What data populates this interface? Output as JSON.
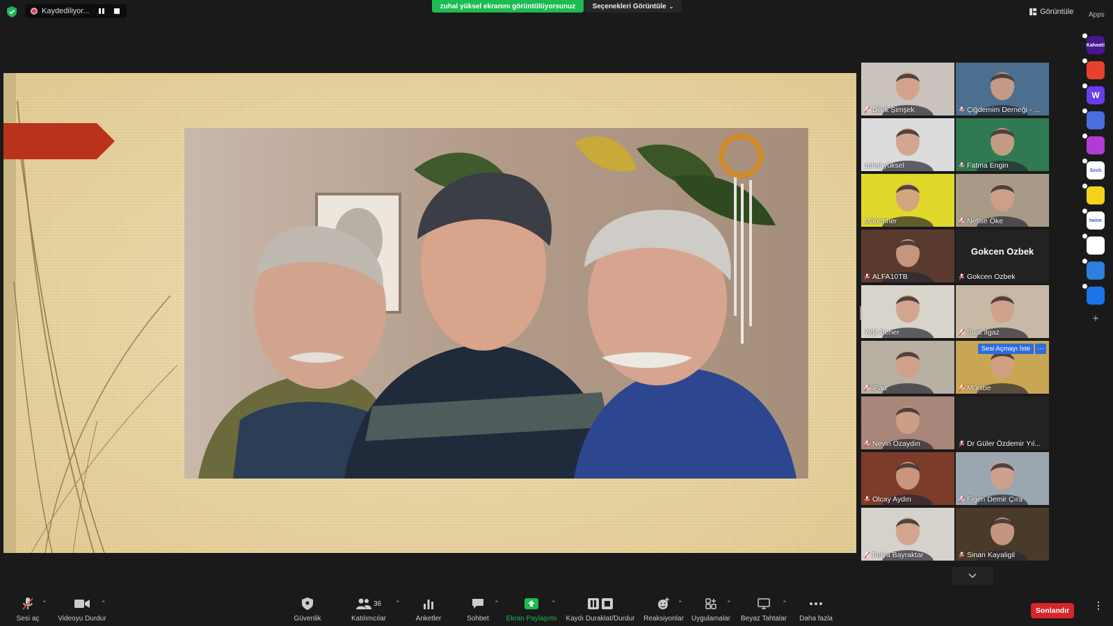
{
  "top": {
    "recording_label": "Kaydediliyor...",
    "share_banner": "zuhal yüksel ekranını görüntülüyorsunuz",
    "view_options": "Seçenekleri Görüntüle",
    "view_button": "Görüntüle",
    "apps_label": "Apps"
  },
  "gallery": {
    "tiles": [
      {
        "name": "Dilek Şimşek",
        "muted": true,
        "active": true,
        "bg": "#c9c2bd"
      },
      {
        "name": "Çiğdemim Derneği - ...",
        "muted": true,
        "bg": "#4c6f8f"
      },
      {
        "name": "zuhal yüksel",
        "muted": false,
        "bg": "#dcdcdc"
      },
      {
        "name": "Fatma Engin",
        "muted": true,
        "bg": "#2f7a52"
      },
      {
        "name": "Mübehher",
        "muted": false,
        "bg": "#e0d82a"
      },
      {
        "name": "Nefise Öke",
        "muted": true,
        "bg": "#a99a88"
      },
      {
        "name": "ALFA10TB",
        "muted": true,
        "bg": "#5a3a2e"
      },
      {
        "name": "Gokcen Ozbek",
        "muted": true,
        "bg": "#222222",
        "big_name": "Gokcen Ozbek"
      },
      {
        "name": "Yiğit Bener",
        "muted": false,
        "bg": "#d8d4cc"
      },
      {
        "name": "Suat Ilgaz",
        "muted": true,
        "bg": "#c7b9a6"
      },
      {
        "name": "iPad",
        "muted": true,
        "bg": "#b9b0a4"
      },
      {
        "name": "Münibe",
        "muted": true,
        "bg": "#c9a653",
        "ask_unmute": "Sesi Açmayı İste"
      },
      {
        "name": "Nevin Özaydın",
        "muted": true,
        "bg": "#a8867a"
      },
      {
        "name": "Dr Güler Özdemir Yıl...",
        "muted": true,
        "bg": "#222222"
      },
      {
        "name": "Olcay Aydın",
        "muted": true,
        "bg": "#7d3b2a"
      },
      {
        "name": "Figen Demir Çıra",
        "muted": true,
        "bg": "#9aa6b0"
      },
      {
        "name": "Fulya Bayraktar",
        "muted": true,
        "bg": "#d5d1cb"
      },
      {
        "name": "Sinan Kayaligil",
        "muted": true,
        "bg": "#4a3a2a"
      }
    ]
  },
  "apps": [
    {
      "icon": "kahoot-icon",
      "text": "Kahoot!",
      "color": "#46178f"
    },
    {
      "icon": "red-app-icon",
      "text": "",
      "color": "#e8402b"
    },
    {
      "icon": "w-app-icon",
      "text": "W",
      "color": "#6a3de8"
    },
    {
      "icon": "circle-app-icon",
      "text": "",
      "color": "#4a6ee0"
    },
    {
      "icon": "wave-app-icon",
      "text": "",
      "color": "#b23bd6"
    },
    {
      "icon": "sesh-icon",
      "text": "Sesh",
      "color": "#ffffff"
    },
    {
      "icon": "emoji-app-icon",
      "text": "",
      "color": "#f7d21b"
    },
    {
      "icon": "twine-icon",
      "text": "twine",
      "color": "#ffffff"
    },
    {
      "icon": "grid-app-icon",
      "text": "",
      "color": "#ffffff"
    },
    {
      "icon": "sync-app-icon",
      "text": "",
      "color": "#2d7fe0"
    },
    {
      "icon": "e-app-icon",
      "text": "",
      "color": "#1a73e8"
    }
  ],
  "toolbar": {
    "unmute": "Sesi aç",
    "stop_video": "Videoyu Durdur",
    "security": "Güvenlik",
    "participants": "Katılımcılar",
    "participants_count": "36",
    "polls": "Anketler",
    "chat": "Sohbet",
    "share_screen": "Ekran Paylaşımı",
    "pause_stop_recording": "Kaydı Duraklat/Durdur",
    "reactions": "Reaksiyonlar",
    "apps": "Uygulamalar",
    "whiteboards": "Beyaz Tahtalar",
    "more": "Daha fazla",
    "end": "Sonlandır"
  },
  "colors": {
    "share_green": "#1dbb52",
    "end_red": "#d7262a",
    "active_speaker": "#d6e66a",
    "ask_blue": "#2d6de0"
  }
}
